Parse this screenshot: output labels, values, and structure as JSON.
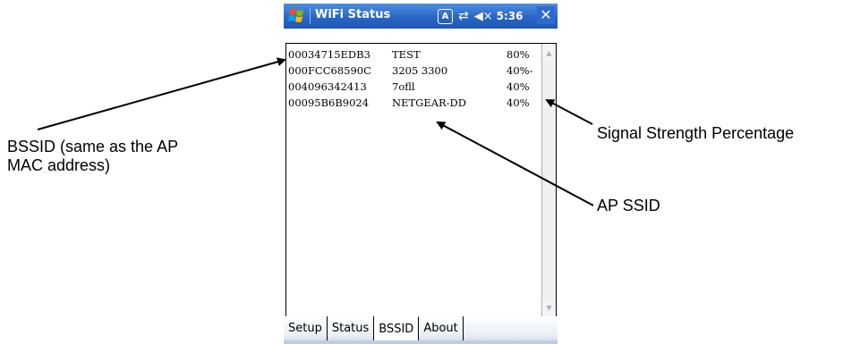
{
  "window": {
    "title": "WiFi Status",
    "time": "5:36",
    "close_label": "✕",
    "ime_label": "A"
  },
  "bssid_list": {
    "rows": [
      {
        "bssid": "00034715EDB3",
        "ssid": "TEST",
        "signal": "80%"
      },
      {
        "bssid": "000FCC68590C",
        "ssid": "3205 3300",
        "signal": "40%-"
      },
      {
        "bssid": "004096342413",
        "ssid": "7ofll",
        "signal": "40%"
      },
      {
        "bssid": "00095B6B9024",
        "ssid": "NETGEAR-DD",
        "signal": "40%"
      }
    ]
  },
  "tabs": [
    {
      "label": "Setup"
    },
    {
      "label": "Status"
    },
    {
      "label": "BSSID",
      "active": true
    },
    {
      "label": "About"
    }
  ],
  "callouts": {
    "bssid_line1": "BSSID (same as the AP",
    "bssid_line2": "MAC address)",
    "signal": "Signal Strength Percentage",
    "ssid": "AP SSID"
  },
  "icons": {
    "start": "windows-flag-icon",
    "ime": "input-mode-icon",
    "connectivity": "connectivity-icon",
    "volume": "volume-muted-icon",
    "close": "close-icon",
    "scroll_up": "scroll-up-arrow-icon",
    "scroll_down": "scroll-down-arrow-icon"
  },
  "colors": {
    "titlebar": "#2a66c6",
    "accent": "#1f57b3"
  }
}
